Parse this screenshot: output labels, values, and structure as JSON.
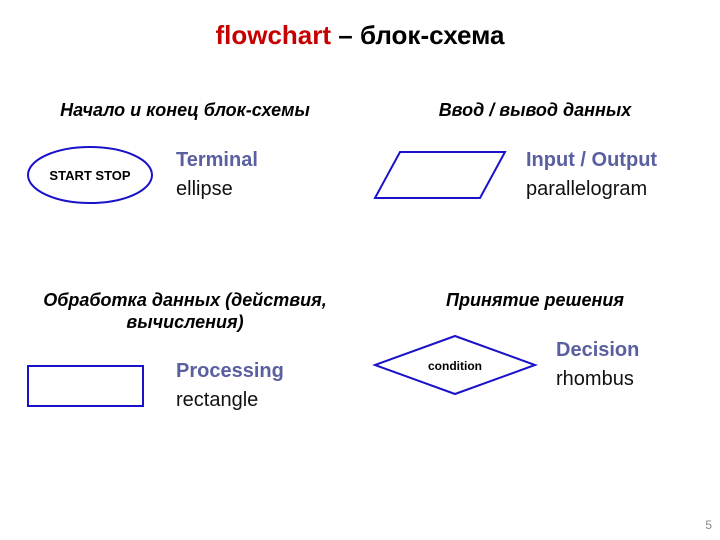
{
  "title": {
    "red": "flowchart",
    "dash": " – ",
    "black": "блок-схема"
  },
  "cells": {
    "terminal": {
      "ru": "Начало и конец блок-схемы",
      "en": "Terminal",
      "shape": "ellipse",
      "inner": "START STOP"
    },
    "io": {
      "ru": "Ввод / вывод данных",
      "en": "Input / Output",
      "shape": "parallelogram",
      "inner": ""
    },
    "processing": {
      "ru": "Обработка данных (действия, вычисления)",
      "en": "Processing",
      "shape": "rectangle",
      "inner": ""
    },
    "decision": {
      "ru": "Принятие решения",
      "en": "Decision",
      "shape": "rhombus",
      "inner": "condition"
    }
  },
  "page_number": "5",
  "colors": {
    "stroke": "#1a12c9",
    "term": "#5a5fa0",
    "red": "#c60000"
  }
}
